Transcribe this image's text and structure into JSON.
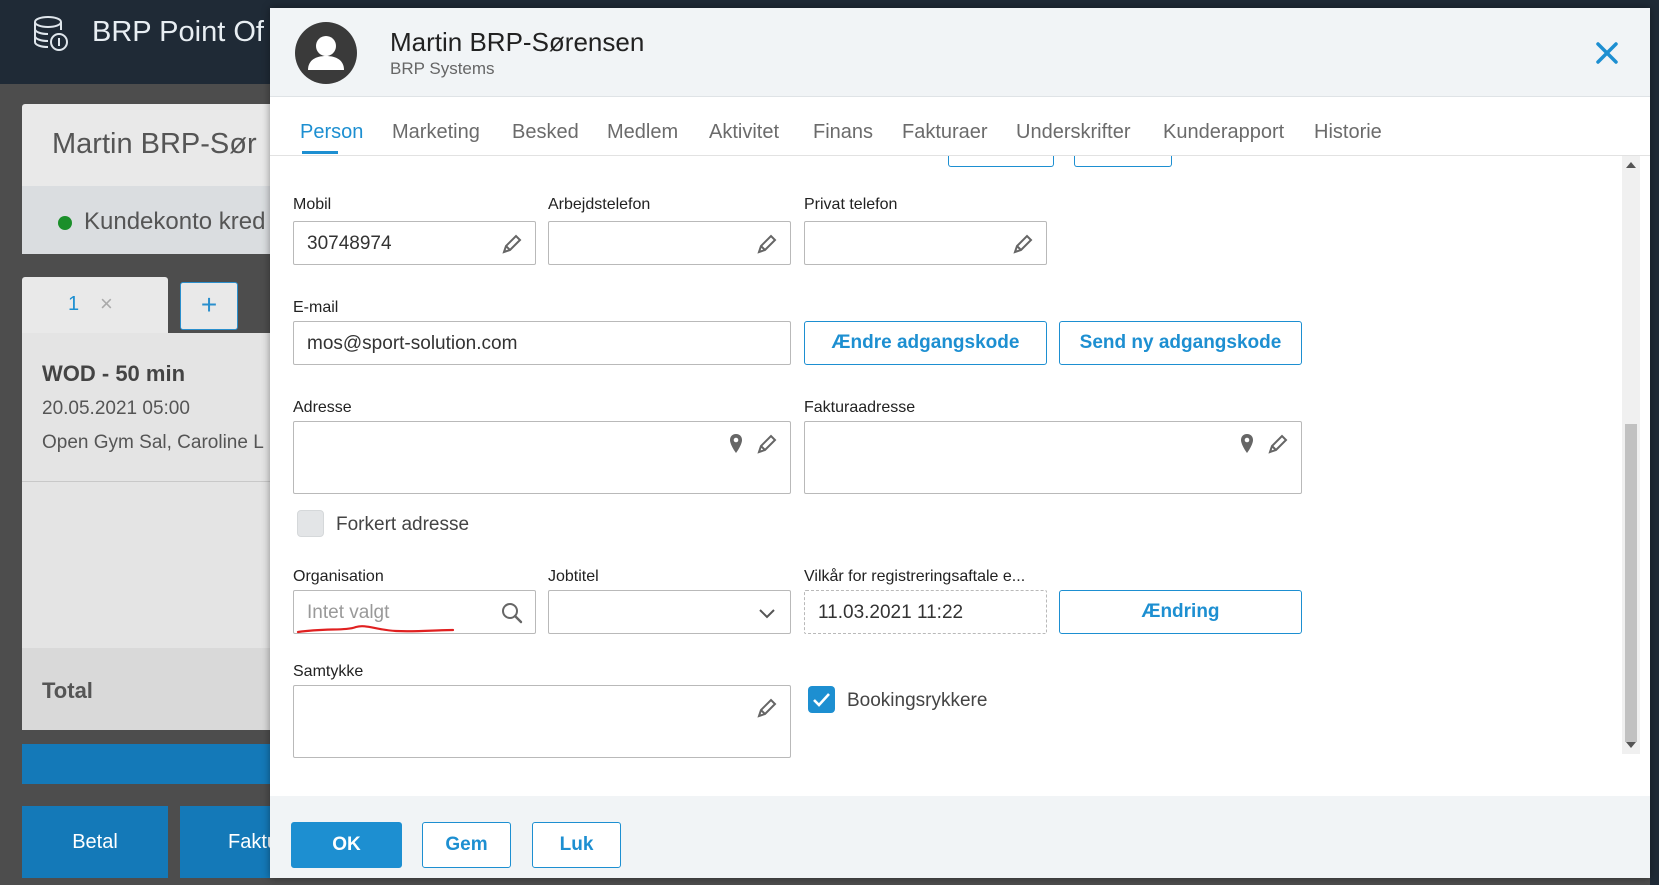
{
  "background": {
    "app_title": "BRP Point Of",
    "customer_name": "Martin BRP-Sør",
    "account_status": "Kundekonto kred",
    "cart_tab_number": "1",
    "cart_tab_close": "×",
    "add_tab": "+",
    "order_item_title": "WOD - 50 min",
    "order_item_date": "20.05.2021 05:00",
    "order_item_location": "Open Gym Sal, Caroline L",
    "total_label": "Total",
    "pay_button": "Betal",
    "invoice_button": "Faktu"
  },
  "modal": {
    "person_name": "Martin BRP-Sørensen",
    "organization": "BRP Systems",
    "tabs": [
      {
        "label": "Person",
        "active": true
      },
      {
        "label": "Marketing",
        "active": false
      },
      {
        "label": "Besked",
        "active": false
      },
      {
        "label": "Medlem",
        "active": false
      },
      {
        "label": "Aktivitet",
        "active": false
      },
      {
        "label": "Finans",
        "active": false
      },
      {
        "label": "Fakturaer",
        "active": false
      },
      {
        "label": "Underskrifter",
        "active": false
      },
      {
        "label": "Kunderapport",
        "active": false
      },
      {
        "label": "Historie",
        "active": false
      }
    ],
    "fields": {
      "mobile_label": "Mobil",
      "mobile_value": "30748974",
      "work_phone_label": "Arbejdstelefon",
      "work_phone_value": "",
      "private_phone_label": "Privat telefon",
      "private_phone_value": "",
      "email_label": "E-mail",
      "email_value": "mos@sport-solution.com",
      "change_password_button": "Ændre adgangskode",
      "send_password_button": "Send ny adgangskode",
      "address_label": "Adresse",
      "billing_address_label": "Fakturaadresse",
      "wrong_address_label": "Forkert adresse",
      "wrong_address_checked": false,
      "organisation_label": "Organisation",
      "organisation_placeholder": "Intet valgt",
      "job_title_label": "Jobtitel",
      "job_title_value": "",
      "terms_label": "Vilkår for registreringsaftale e...",
      "terms_value": "11.03.2021 11:22",
      "change_button": "Ændring",
      "consent_label": "Samtykke",
      "booking_reminder_label": "Bookingsrykkere",
      "booking_reminder_checked": true
    },
    "footer": {
      "ok": "OK",
      "save": "Gem",
      "close": "Luk"
    }
  },
  "colors": {
    "accent": "#1d8fd1",
    "topbar": "#1f2a36",
    "annotation": "#e02020"
  }
}
